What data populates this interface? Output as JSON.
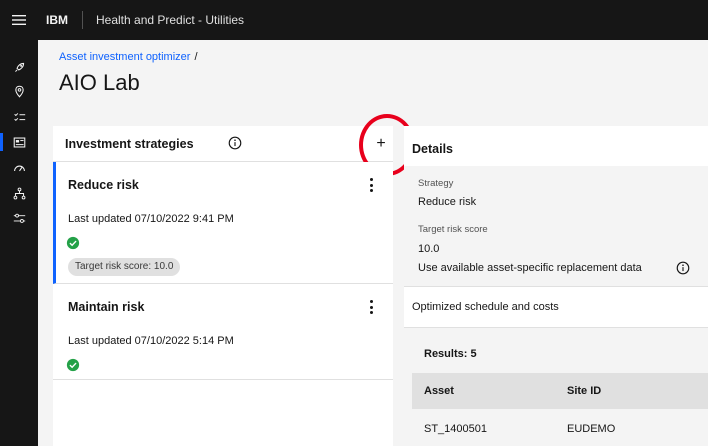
{
  "header": {
    "brand": "IBM",
    "app_name": "Health and Predict - Utilities"
  },
  "sidebar": {
    "items": [
      {
        "icon": "rocket-icon",
        "active": false
      },
      {
        "icon": "location-icon",
        "active": false
      },
      {
        "icon": "task-list-icon",
        "active": false
      },
      {
        "icon": "dashboard-icon",
        "active": true
      },
      {
        "icon": "gauge-icon",
        "active": false
      },
      {
        "icon": "hierarchy-icon",
        "active": false
      },
      {
        "icon": "settings-adjust-icon",
        "active": false
      }
    ]
  },
  "breadcrumb": {
    "link": "Asset investment optimizer",
    "separator": "/"
  },
  "page": {
    "title": "AIO Lab"
  },
  "strategies": {
    "title": "Investment strategies",
    "add_label": "+",
    "items": [
      {
        "name": "Reduce risk",
        "updated": "Last updated 07/10/2022 9:41 PM",
        "status": "success",
        "tag": "Target risk score: 10.0"
      },
      {
        "name": "Maintain risk",
        "updated": "Last updated 07/10/2022 5:14 PM",
        "status": "success"
      }
    ]
  },
  "details": {
    "title": "Details",
    "strategy_label": "Strategy",
    "strategy_value": "Reduce risk",
    "target_label": "Target risk score",
    "target_value": "10.0",
    "replacement_label": "Use available asset-specific replacement data",
    "optimized_label": "Optimized schedule and costs",
    "results": "Results: 5",
    "table": {
      "headers": [
        "Asset",
        "Site ID"
      ],
      "rows": [
        [
          "ST_1400501",
          "EUDEMO"
        ]
      ]
    }
  },
  "colors": {
    "accent": "#0f62fe",
    "header_bg": "#161616",
    "success": "#24a148",
    "highlight": "#e8001c"
  }
}
